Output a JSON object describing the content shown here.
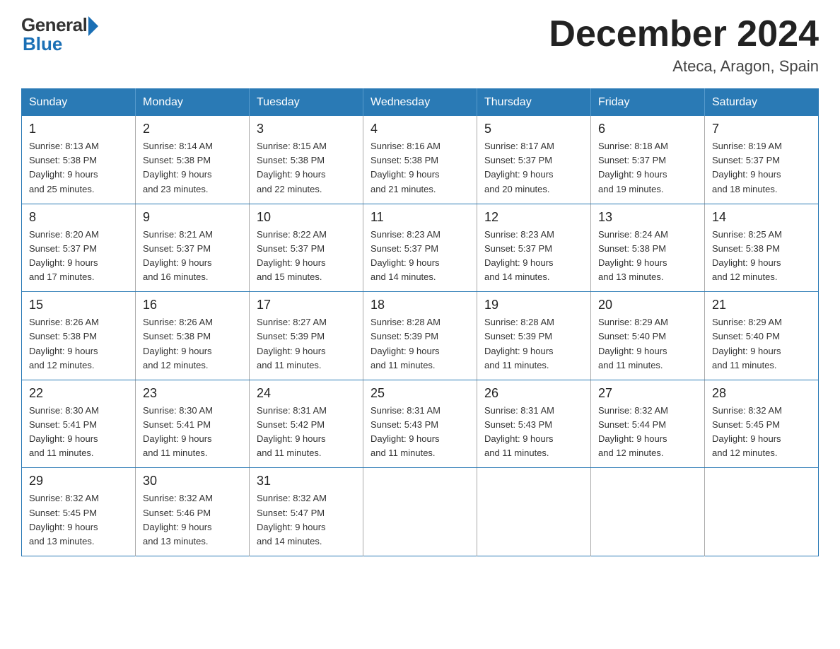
{
  "logo": {
    "general": "General",
    "blue": "Blue"
  },
  "title": {
    "month_year": "December 2024",
    "location": "Ateca, Aragon, Spain"
  },
  "header_days": [
    "Sunday",
    "Monday",
    "Tuesday",
    "Wednesday",
    "Thursday",
    "Friday",
    "Saturday"
  ],
  "weeks": [
    [
      {
        "day": "1",
        "sunrise": "8:13 AM",
        "sunset": "5:38 PM",
        "daylight": "9 hours and 25 minutes."
      },
      {
        "day": "2",
        "sunrise": "8:14 AM",
        "sunset": "5:38 PM",
        "daylight": "9 hours and 23 minutes."
      },
      {
        "day": "3",
        "sunrise": "8:15 AM",
        "sunset": "5:38 PM",
        "daylight": "9 hours and 22 minutes."
      },
      {
        "day": "4",
        "sunrise": "8:16 AM",
        "sunset": "5:38 PM",
        "daylight": "9 hours and 21 minutes."
      },
      {
        "day": "5",
        "sunrise": "8:17 AM",
        "sunset": "5:37 PM",
        "daylight": "9 hours and 20 minutes."
      },
      {
        "day": "6",
        "sunrise": "8:18 AM",
        "sunset": "5:37 PM",
        "daylight": "9 hours and 19 minutes."
      },
      {
        "day": "7",
        "sunrise": "8:19 AM",
        "sunset": "5:37 PM",
        "daylight": "9 hours and 18 minutes."
      }
    ],
    [
      {
        "day": "8",
        "sunrise": "8:20 AM",
        "sunset": "5:37 PM",
        "daylight": "9 hours and 17 minutes."
      },
      {
        "day": "9",
        "sunrise": "8:21 AM",
        "sunset": "5:37 PM",
        "daylight": "9 hours and 16 minutes."
      },
      {
        "day": "10",
        "sunrise": "8:22 AM",
        "sunset": "5:37 PM",
        "daylight": "9 hours and 15 minutes."
      },
      {
        "day": "11",
        "sunrise": "8:23 AM",
        "sunset": "5:37 PM",
        "daylight": "9 hours and 14 minutes."
      },
      {
        "day": "12",
        "sunrise": "8:23 AM",
        "sunset": "5:37 PM",
        "daylight": "9 hours and 14 minutes."
      },
      {
        "day": "13",
        "sunrise": "8:24 AM",
        "sunset": "5:38 PM",
        "daylight": "9 hours and 13 minutes."
      },
      {
        "day": "14",
        "sunrise": "8:25 AM",
        "sunset": "5:38 PM",
        "daylight": "9 hours and 12 minutes."
      }
    ],
    [
      {
        "day": "15",
        "sunrise": "8:26 AM",
        "sunset": "5:38 PM",
        "daylight": "9 hours and 12 minutes."
      },
      {
        "day": "16",
        "sunrise": "8:26 AM",
        "sunset": "5:38 PM",
        "daylight": "9 hours and 12 minutes."
      },
      {
        "day": "17",
        "sunrise": "8:27 AM",
        "sunset": "5:39 PM",
        "daylight": "9 hours and 11 minutes."
      },
      {
        "day": "18",
        "sunrise": "8:28 AM",
        "sunset": "5:39 PM",
        "daylight": "9 hours and 11 minutes."
      },
      {
        "day": "19",
        "sunrise": "8:28 AM",
        "sunset": "5:39 PM",
        "daylight": "9 hours and 11 minutes."
      },
      {
        "day": "20",
        "sunrise": "8:29 AM",
        "sunset": "5:40 PM",
        "daylight": "9 hours and 11 minutes."
      },
      {
        "day": "21",
        "sunrise": "8:29 AM",
        "sunset": "5:40 PM",
        "daylight": "9 hours and 11 minutes."
      }
    ],
    [
      {
        "day": "22",
        "sunrise": "8:30 AM",
        "sunset": "5:41 PM",
        "daylight": "9 hours and 11 minutes."
      },
      {
        "day": "23",
        "sunrise": "8:30 AM",
        "sunset": "5:41 PM",
        "daylight": "9 hours and 11 minutes."
      },
      {
        "day": "24",
        "sunrise": "8:31 AM",
        "sunset": "5:42 PM",
        "daylight": "9 hours and 11 minutes."
      },
      {
        "day": "25",
        "sunrise": "8:31 AM",
        "sunset": "5:43 PM",
        "daylight": "9 hours and 11 minutes."
      },
      {
        "day": "26",
        "sunrise": "8:31 AM",
        "sunset": "5:43 PM",
        "daylight": "9 hours and 11 minutes."
      },
      {
        "day": "27",
        "sunrise": "8:32 AM",
        "sunset": "5:44 PM",
        "daylight": "9 hours and 12 minutes."
      },
      {
        "day": "28",
        "sunrise": "8:32 AM",
        "sunset": "5:45 PM",
        "daylight": "9 hours and 12 minutes."
      }
    ],
    [
      {
        "day": "29",
        "sunrise": "8:32 AM",
        "sunset": "5:45 PM",
        "daylight": "9 hours and 13 minutes."
      },
      {
        "day": "30",
        "sunrise": "8:32 AM",
        "sunset": "5:46 PM",
        "daylight": "9 hours and 13 minutes."
      },
      {
        "day": "31",
        "sunrise": "8:32 AM",
        "sunset": "5:47 PM",
        "daylight": "9 hours and 14 minutes."
      },
      null,
      null,
      null,
      null
    ]
  ]
}
